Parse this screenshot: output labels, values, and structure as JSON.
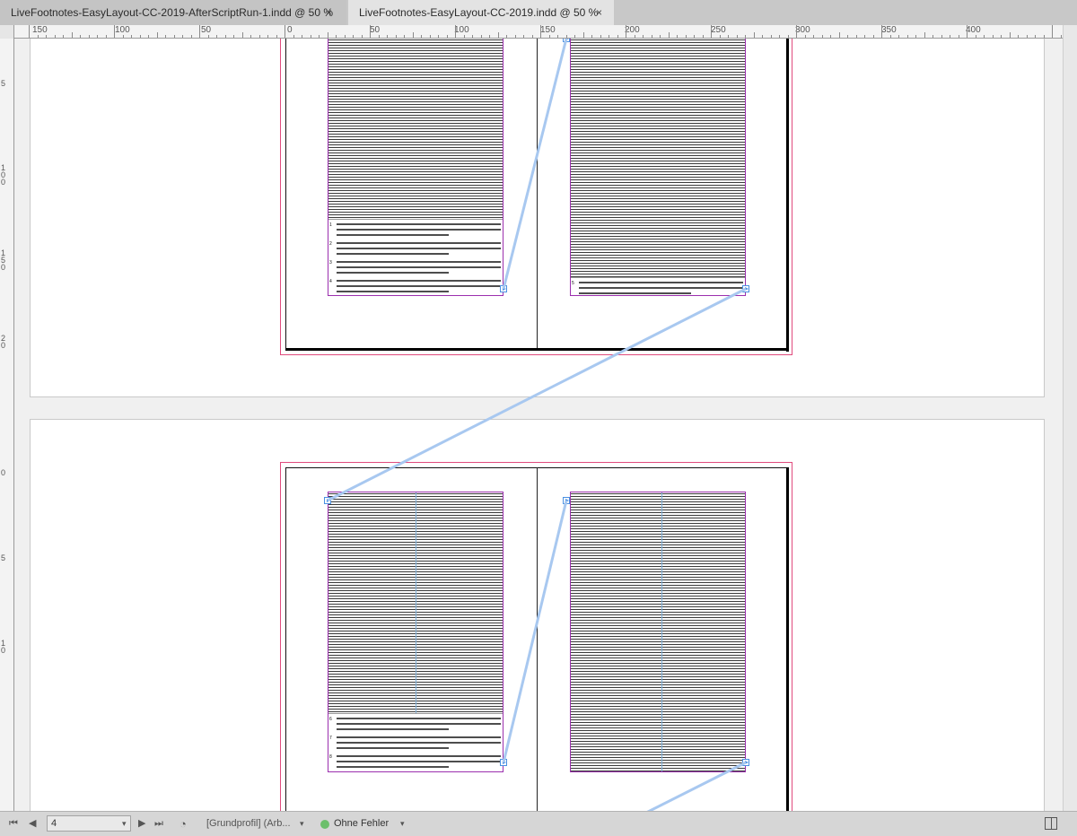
{
  "tabs": [
    {
      "label": "LiveFootnotes-EasyLayout-CC-2019-AfterScriptRun-1.indd @ 50 %",
      "close": "×",
      "active": false
    },
    {
      "label": "LiveFootnotes-EasyLayout-CC-2019.indd @ 50 %",
      "close": "×",
      "active": true
    }
  ],
  "ruler": {
    "h_labels": [
      "150",
      "100",
      "50",
      "0",
      "50",
      "100",
      "150",
      "200",
      "250",
      "300",
      "350",
      "400"
    ],
    "v_labels": [
      "5",
      "1 0 0",
      "1 5 0",
      "2 0",
      "0",
      "5",
      "1 0"
    ]
  },
  "footnotes": {
    "page1": [
      "1",
      "2",
      "3",
      "4"
    ],
    "page2": [
      "5"
    ],
    "page3": [
      "6",
      "7",
      "8"
    ]
  },
  "statusbar": {
    "page_value": "4",
    "profile": "[Grundprofil] (Arb...",
    "preflight": "Ohne Fehler",
    "preflight_color": "#6cbf6b"
  },
  "icons": {
    "first": "first-page-icon",
    "prev": "previous-page-icon",
    "next": "next-page-icon",
    "last": "last-page-icon",
    "chevron": "chevron-down-icon"
  },
  "colors": {
    "frame": "#9b2fae",
    "bleed": "#e04b7d",
    "thread": "#a8c8f0",
    "column_guide": "#7fb0d8"
  }
}
